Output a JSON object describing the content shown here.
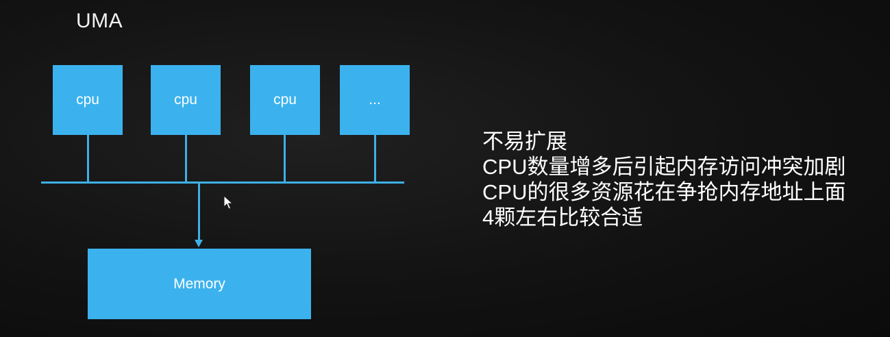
{
  "diagram": {
    "title": "UMA",
    "cpus": [
      {
        "label": "cpu"
      },
      {
        "label": "cpu"
      },
      {
        "label": "cpu"
      },
      {
        "label": "..."
      }
    ],
    "memory_label": "Memory"
  },
  "notes": [
    "不易扩展",
    "CPU数量增多后引起内存访问冲突加剧",
    "CPU的很多资源花在争抢内存地址上面",
    "4颗左右比较合适"
  ],
  "colors": {
    "box_fill": "#3bb2ee",
    "line": "#3fb0e6",
    "background": "#151515",
    "text": "#ffffff"
  }
}
